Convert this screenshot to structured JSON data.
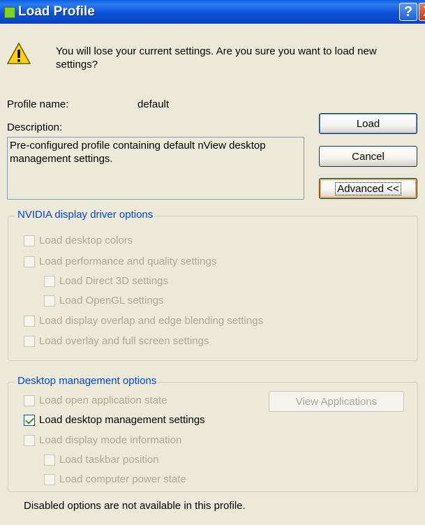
{
  "window": {
    "title": "Load Profile",
    "help_glyph": "?",
    "close_glyph": "X"
  },
  "warning": {
    "icon": "warning-icon",
    "message": "You will lose your current settings. Are you sure you want to load new settings?"
  },
  "profile": {
    "name_label": "Profile name:",
    "name_value": "default",
    "description_label": "Description:",
    "description_value": "Pre-configured profile containing default nView desktop management settings."
  },
  "buttons": {
    "load": "Load",
    "cancel": "Cancel",
    "advanced": "Advanced <<",
    "view_applications": "View Applications"
  },
  "nvidia_group": {
    "legend": "NVIDIA display driver options",
    "options": [
      {
        "label": "Load desktop colors",
        "checked": false,
        "enabled": false
      },
      {
        "label": "Load performance and quality settings",
        "checked": false,
        "enabled": false
      },
      {
        "label": "Load Direct 3D settings",
        "checked": false,
        "enabled": false
      },
      {
        "label": "Load OpenGL settings",
        "checked": false,
        "enabled": false
      },
      {
        "label": "Load display overlap and edge blending settings",
        "checked": false,
        "enabled": false
      },
      {
        "label": "Load overlay and full screen settings",
        "checked": false,
        "enabled": false
      }
    ]
  },
  "desktop_group": {
    "legend": "Desktop management options",
    "options": [
      {
        "label": "Load open application state",
        "checked": false,
        "enabled": false
      },
      {
        "label": "Load desktop management settings",
        "checked": true,
        "enabled": true
      },
      {
        "label": "Load display mode information",
        "checked": false,
        "enabled": false
      },
      {
        "label": "Load taskbar position",
        "checked": false,
        "enabled": false
      },
      {
        "label": "Load computer power state",
        "checked": false,
        "enabled": false
      }
    ]
  },
  "footer": "Disabled options are not available in this profile.",
  "colors": {
    "titlebar": "#0843c2",
    "dialog_bg": "#ece9d8",
    "group_legend": "#0046d5",
    "disabled_text": "#aca899",
    "check_mark": "#21a121"
  }
}
